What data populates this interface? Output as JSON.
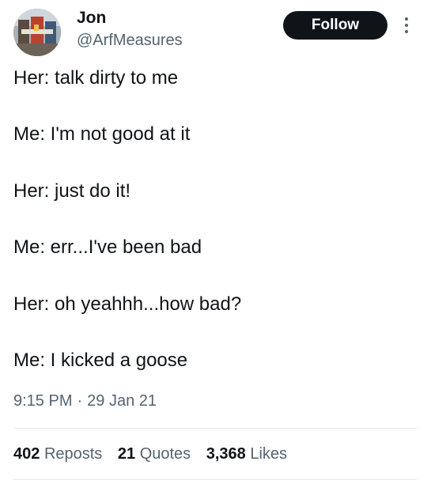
{
  "author": {
    "display_name": "Jon",
    "handle": "@ArfMeasures",
    "avatar_icon": "avatar-photo"
  },
  "header": {
    "follow_label": "Follow",
    "more_icon": "more-vertical-icon"
  },
  "tweet": {
    "lines": [
      "Her: talk dirty to me",
      "Me: I'm not good at it",
      "Her: just do it!",
      "Me: err...I've been bad",
      "Her: oh yeahhh...how bad?",
      "Me: I kicked a goose"
    ],
    "time": "9:15 PM",
    "separator": "·",
    "date": "29 Jan 21"
  },
  "stats": {
    "reposts_count": "402",
    "reposts_label": "Reposts",
    "quotes_count": "21",
    "quotes_label": "Quotes",
    "likes_count": "3,368",
    "likes_label": "Likes"
  },
  "colors": {
    "text_primary": "#0f1419",
    "text_secondary": "#536471",
    "follow_bg": "#0f1419",
    "follow_text": "#ffffff",
    "divider": "#e6e9eb"
  }
}
